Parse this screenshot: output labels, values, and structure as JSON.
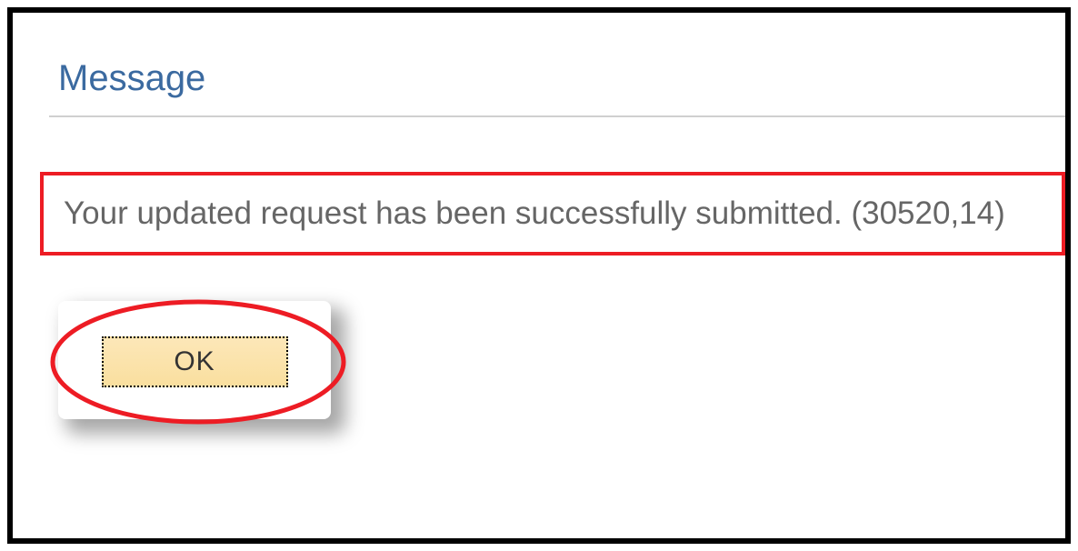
{
  "dialog": {
    "title": "Message",
    "body": "Your updated request has been successfully submitted. (30520,14)",
    "ok_label": "OK"
  }
}
